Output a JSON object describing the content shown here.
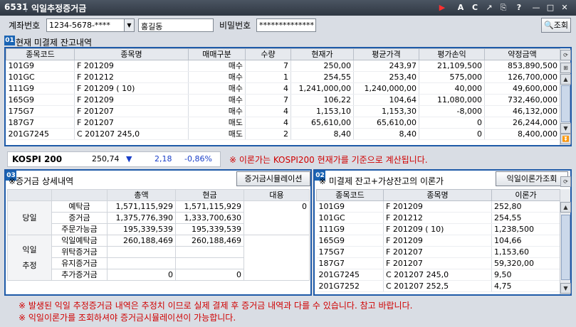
{
  "window": {
    "code": "6531",
    "title": "익일추정증거금",
    "buttons": [
      "▶",
      "A",
      "C",
      "↗",
      "⎘",
      "?",
      "—",
      "□",
      "✕"
    ]
  },
  "account": {
    "account_label": "계좌번호",
    "account_no": "1234-5678-****",
    "owner": "홍길동",
    "password_label": "비밀번호",
    "password": "**************",
    "search_label": "조회"
  },
  "section1": {
    "badge": "01",
    "title": "현재 미결제 잔고내역",
    "headers": [
      "종목코드",
      "종목명",
      "매매구분",
      "수량",
      "현재가",
      "평균가격",
      "평가손익",
      "약정금액"
    ],
    "rows": [
      [
        "101G9",
        "F 201209",
        "매수",
        "7",
        "250,00",
        "243,97",
        "21,109,500",
        "853,890,500"
      ],
      [
        "101GC",
        "F 201212",
        "매수",
        "1",
        "254,55",
        "253,40",
        "575,000",
        "126,700,000"
      ],
      [
        "111G9",
        "F 201209 (   10)",
        "매수",
        "4",
        "1,241,000,00",
        "1,240,000,00",
        "40,000",
        "49,600,000"
      ],
      [
        "165G9",
        "F 201209",
        "매수",
        "7",
        "106,22",
        "104,64",
        "11,080,000",
        "732,460,000"
      ],
      [
        "175G7",
        "F 201207",
        "매수",
        "4",
        "1,153,10",
        "1,153,30",
        "-8,000",
        "46,132,000"
      ],
      [
        "187G7",
        "F 201207",
        "매도",
        "4",
        "65,610,00",
        "65,610,00",
        "0",
        "26,244,000"
      ],
      [
        "201G7245",
        "C 201207 245,0",
        "매도",
        "2",
        "8,40",
        "8,40",
        "0",
        "8,400,000"
      ]
    ]
  },
  "kospi": {
    "label": "KOSPI 200",
    "value": "250,74",
    "arrow": "▼",
    "change": "2,18",
    "rate": "-0,86%",
    "note": "※ 이론가는 KOSPI200 현재가를 기준으로 계산됩니다."
  },
  "section3": {
    "badge": "03",
    "title": "※증거금 상세내역",
    "sim_button": "증거금시뮬레이션",
    "headers": [
      "",
      "",
      "총액",
      "현금",
      "대용"
    ],
    "group1": "당일",
    "group2a": "익일",
    "group2b": "추정",
    "rows": [
      [
        "예탁금",
        "1,571,115,929",
        "1,571,115,929",
        "0"
      ],
      [
        "증거금",
        "1,375,776,390",
        "1,333,700,630",
        ""
      ],
      [
        "주문가능금",
        "195,339,539",
        "195,339,539",
        ""
      ],
      [
        "익일예탁금",
        "260,188,469",
        "260,188,469",
        ""
      ],
      [
        "위탁증거금",
        "",
        "",
        ""
      ],
      [
        "유지증거금",
        "",
        "",
        ""
      ],
      [
        "추가증거금",
        "0",
        "0",
        ""
      ]
    ]
  },
  "section2": {
    "badge": "02",
    "title": "※ 미결제 잔고+가상잔고의 이론가",
    "theory_button": "익일이론가조회",
    "headers": [
      "종목코드",
      "종목명",
      "이론가"
    ],
    "rows": [
      [
        "101G9",
        "F 201209",
        "252,80"
      ],
      [
        "101GC",
        "F 201212",
        "254,55"
      ],
      [
        "111G9",
        "F 201209 (   10)",
        "1,238,500"
      ],
      [
        "165G9",
        "F 201209",
        "104,66"
      ],
      [
        "175G7",
        "F 201207",
        "1,153,60"
      ],
      [
        "187G7",
        "F 201207",
        "59,320,00"
      ],
      [
        "201G7245",
        "C 201207 245,0",
        "9,50"
      ],
      [
        "201G7252",
        "C 201207 252,5",
        "4,75"
      ]
    ]
  },
  "footer": {
    "note1": "※ 발생된 익일 추정증거금 내역은 추정치 이므로 실제 결제 후 증거금 내역과 다를 수 있습니다. 참고 바랍니다.",
    "note2": "※ 익일이론가를 조회하셔야 증거금시뮬레이션이 가능합니다."
  },
  "colors": {
    "accent": "#1e5aa8",
    "warning": "#d00000",
    "down": "#1a3fc8"
  }
}
